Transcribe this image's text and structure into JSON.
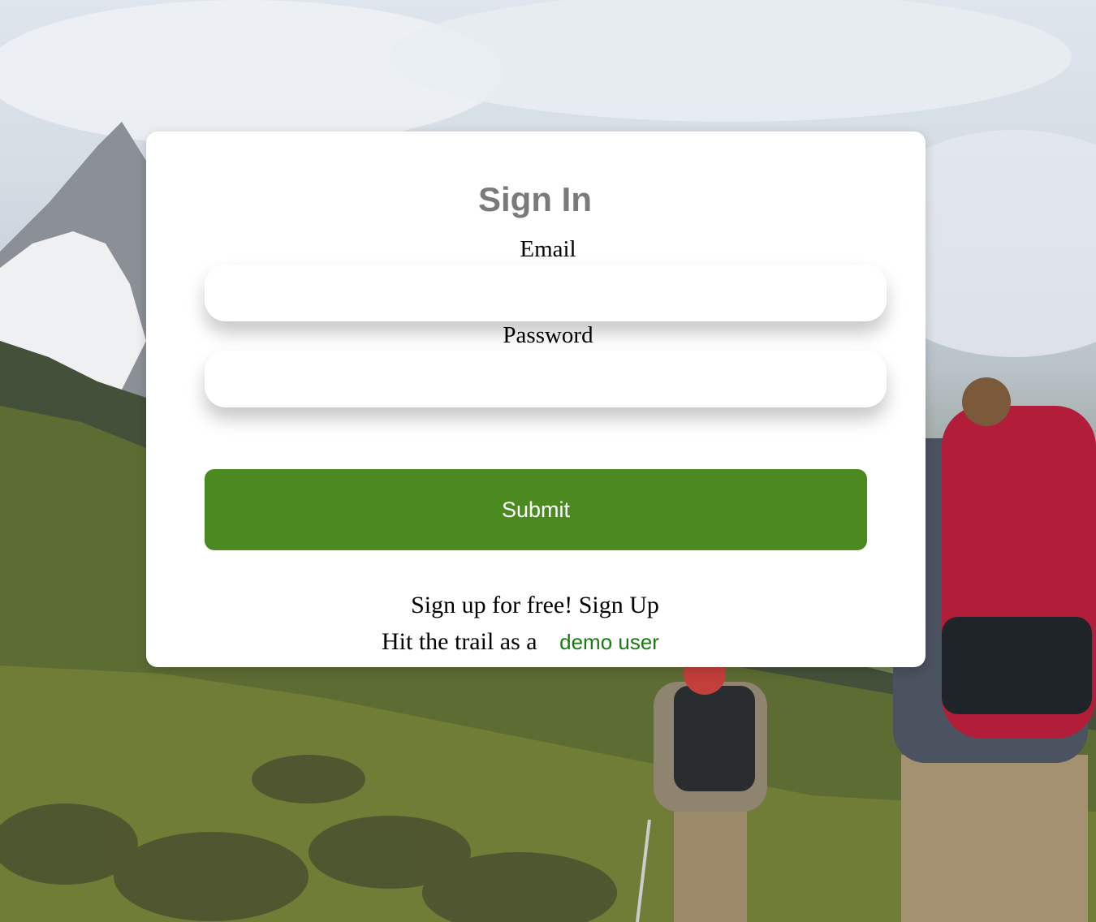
{
  "signin": {
    "title": "Sign In",
    "email_label": "Email",
    "email_value": "",
    "password_label": "Password",
    "password_value": "",
    "submit_label": "Submit"
  },
  "footer": {
    "signup_prompt": "Sign up for free!",
    "signup_link": "Sign Up",
    "demo_prompt": "Hit the trail as a",
    "demo_link": "demo user"
  },
  "colors": {
    "accent": "#4a8a20",
    "link_green": "#1a7a14",
    "title_gray": "#7a7a7a"
  },
  "background": {
    "description_icon": "mountain-hikers-photo"
  }
}
